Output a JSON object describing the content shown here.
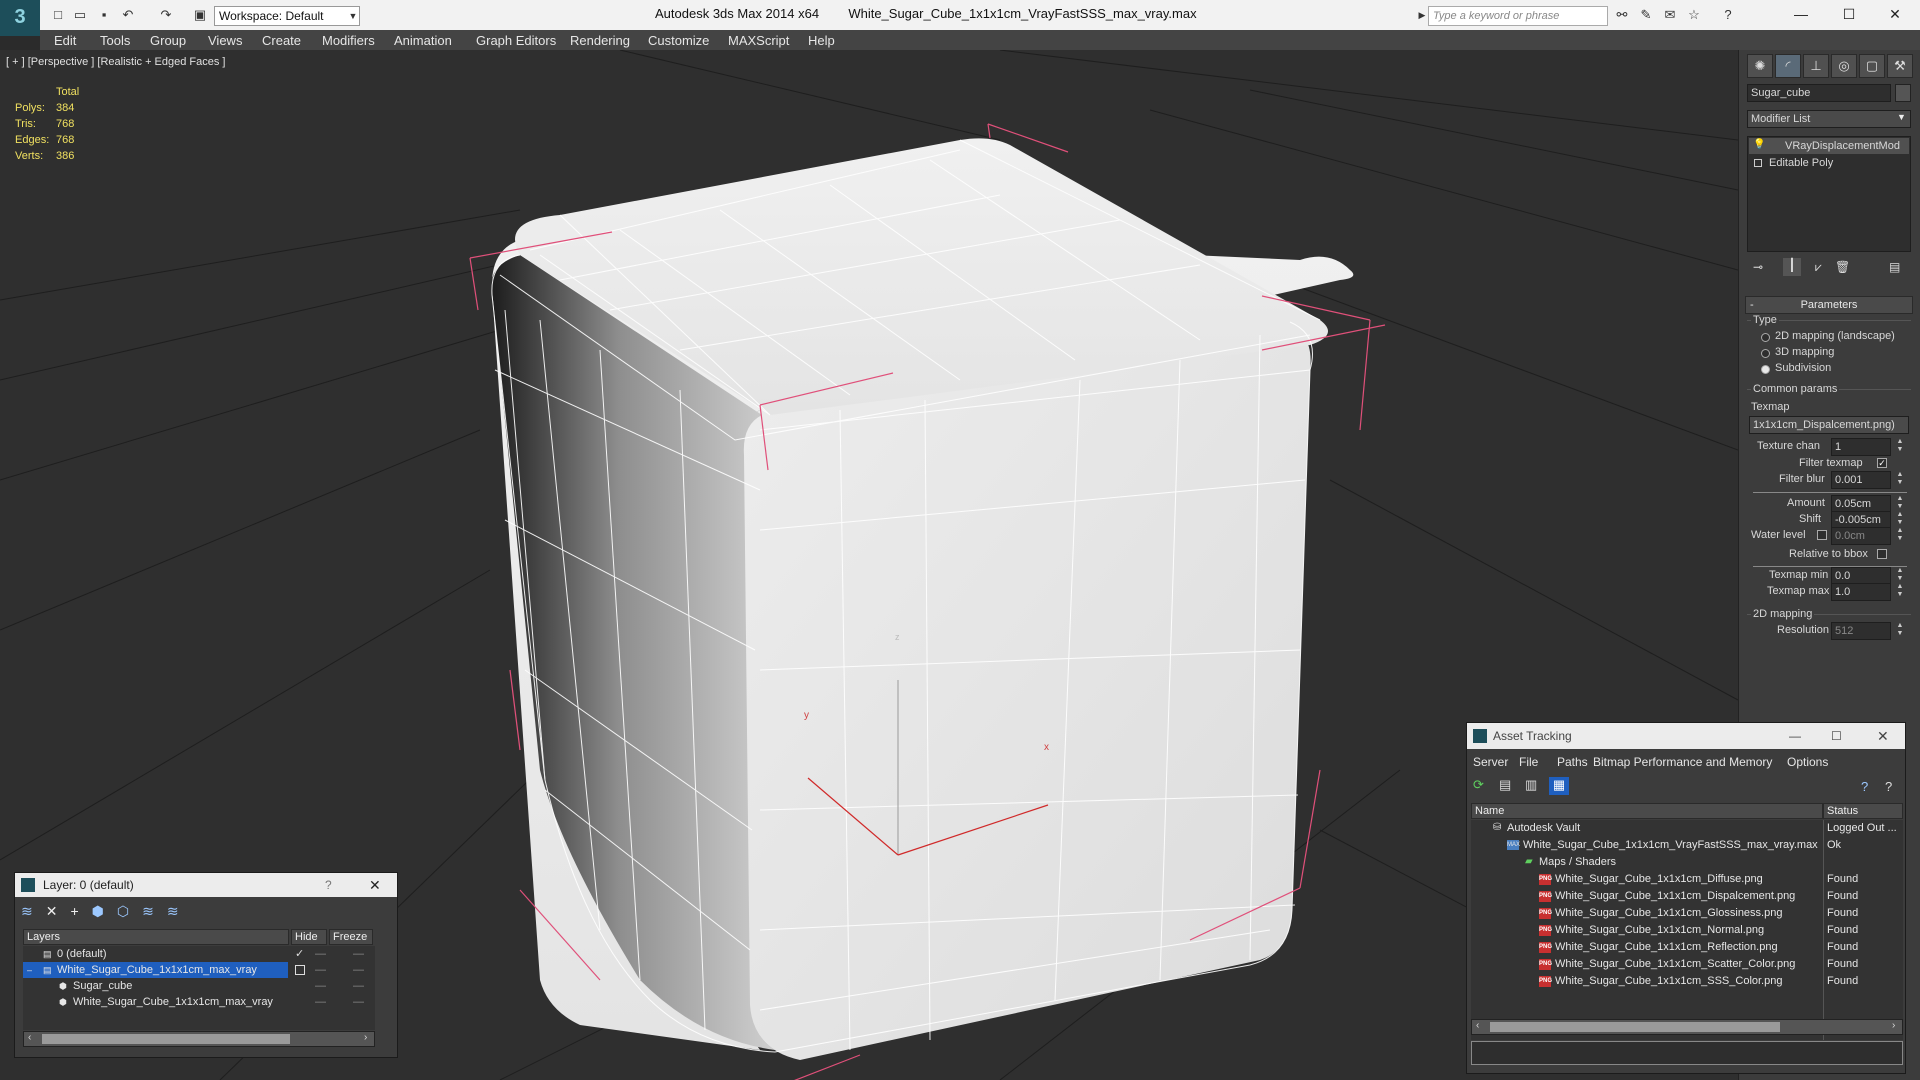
{
  "titlebar": {
    "app_name": "Autodesk 3ds Max  2014 x64",
    "file_name": "White_Sugar_Cube_1x1x1cm_VrayFastSSS_max_vray.max",
    "workspace": "Workspace: Default",
    "search_placeholder": "Type a keyword or phrase"
  },
  "menu": [
    "Edit",
    "Tools",
    "Group",
    "Views",
    "Create",
    "Modifiers",
    "Animation",
    "Graph Editors",
    "Rendering",
    "Customize",
    "MAXScript",
    "Help"
  ],
  "viewport": {
    "label": "[ + ] [Perspective ] [Realistic + Edged Faces ]",
    "stats": {
      "total_label": "Total",
      "rows": [
        {
          "label": "Polys:",
          "value": "384"
        },
        {
          "label": "Tris:",
          "value": "768"
        },
        {
          "label": "Edges:",
          "value": "768"
        },
        {
          "label": "Verts:",
          "value": "386"
        }
      ]
    },
    "axes": {
      "x": "x",
      "y": "y",
      "z": "z"
    }
  },
  "command_panel": {
    "object_name": "Sugar_cube",
    "modifier_list": "Modifier List",
    "stack": [
      "VRayDisplacementMod",
      "Editable Poly"
    ],
    "parameters_title": "Parameters",
    "type_label": "Type",
    "type_options": [
      {
        "label": "2D mapping (landscape)",
        "selected": false
      },
      {
        "label": "3D mapping",
        "selected": false
      },
      {
        "label": "Subdivision",
        "selected": true
      }
    ],
    "common_params": "Common params",
    "texmap_label": "Texmap",
    "texmap_value": "1x1x1cm_Dispalcement.png)",
    "texture_chan_label": "Texture chan",
    "texture_chan_value": "1",
    "filter_texmap_label": "Filter texmap",
    "filter_blur_label": "Filter blur",
    "filter_blur_value": "0.001",
    "amount_label": "Amount",
    "amount_value": "0.05cm",
    "shift_label": "Shift",
    "shift_value": "-0.005cm",
    "water_level_label": "Water level",
    "water_level_value": "0.0cm",
    "relative_bbox_label": "Relative to bbox",
    "texmap_min_label": "Texmap min",
    "texmap_min_value": "0.0",
    "texmap_max_label": "Texmap max",
    "texmap_max_value": "1.0",
    "mapping_2d": "2D mapping",
    "resolution_label": "Resolution",
    "resolution_value": "512"
  },
  "layer_dialog": {
    "title": "Layer: 0 (default)",
    "help": "?",
    "columns": {
      "layers": "Layers",
      "hide": "Hide",
      "freeze": "Freeze"
    },
    "rows": [
      {
        "name": "0 (default)",
        "indent": 0,
        "selected": false
      },
      {
        "name": "White_Sugar_Cube_1x1x1cm_max_vray",
        "indent": 0,
        "selected": true
      },
      {
        "name": "Sugar_cube",
        "indent": 1,
        "selected": false
      },
      {
        "name": "White_Sugar_Cube_1x1x1cm_max_vray",
        "indent": 1,
        "selected": false
      }
    ]
  },
  "asset_dialog": {
    "title": "Asset Tracking",
    "menu": [
      "Server",
      "File",
      "Paths",
      "Bitmap Performance and Memory",
      "Options"
    ],
    "columns": {
      "name": "Name",
      "status": "Status"
    },
    "rows": [
      {
        "name": "Autodesk Vault",
        "status": "Logged Out ...",
        "level": 0,
        "icon": "vault"
      },
      {
        "name": "White_Sugar_Cube_1x1x1cm_VrayFastSSS_max_vray.max",
        "status": "Ok",
        "level": 1,
        "icon": "max"
      },
      {
        "name": "Maps / Shaders",
        "status": "",
        "level": 2,
        "icon": "maps"
      },
      {
        "name": "White_Sugar_Cube_1x1x1cm_Diffuse.png",
        "status": "Found",
        "level": 3,
        "icon": "png"
      },
      {
        "name": "White_Sugar_Cube_1x1x1cm_Dispalcement.png",
        "status": "Found",
        "level": 3,
        "icon": "png"
      },
      {
        "name": "White_Sugar_Cube_1x1x1cm_Glossiness.png",
        "status": "Found",
        "level": 3,
        "icon": "png"
      },
      {
        "name": "White_Sugar_Cube_1x1x1cm_Normal.png",
        "status": "Found",
        "level": 3,
        "icon": "png"
      },
      {
        "name": "White_Sugar_Cube_1x1x1cm_Reflection.png",
        "status": "Found",
        "level": 3,
        "icon": "png"
      },
      {
        "name": "White_Sugar_Cube_1x1x1cm_Scatter_Color.png",
        "status": "Found",
        "level": 3,
        "icon": "png"
      },
      {
        "name": "White_Sugar_Cube_1x1x1cm_SSS_Color.png",
        "status": "Found",
        "level": 3,
        "icon": "png"
      }
    ]
  },
  "colors": {
    "selection": "#1f5fbf",
    "stat_yellow": "#f0e060",
    "bbox_pink": "#e0507a"
  }
}
